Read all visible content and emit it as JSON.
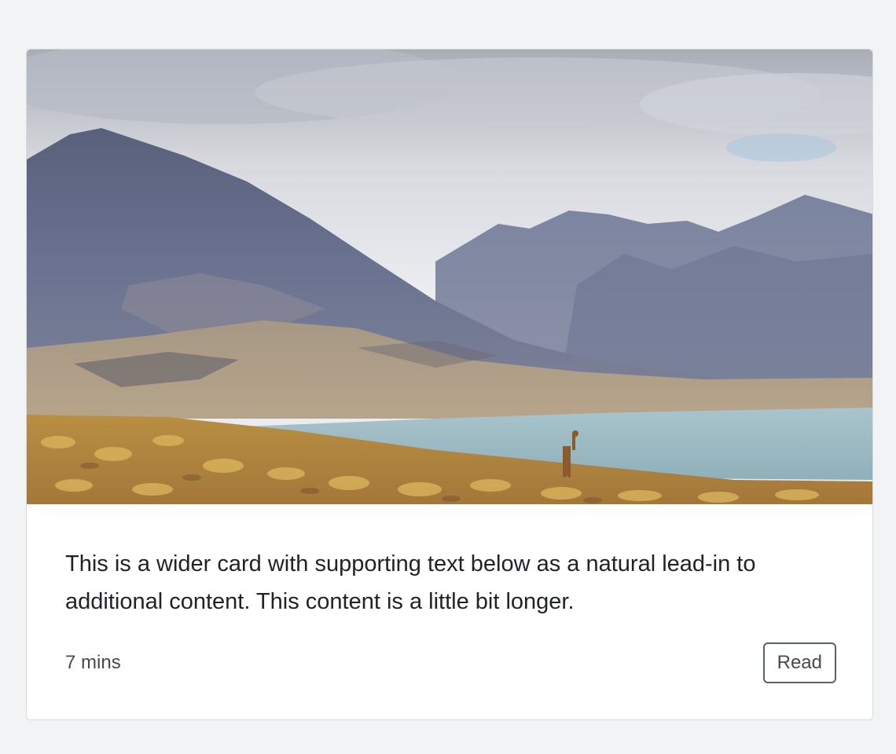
{
  "card": {
    "image_subject": "mountain-lake-landscape",
    "text": "This is a wider card with supporting text below as a natural lead-in to additional content. This content is a little bit longer.",
    "meta": "7 mins",
    "read_label": "Read"
  },
  "colors": {
    "page_background": "#f2f3f5",
    "card_background": "#ffffff",
    "card_border": "#d9dcdf",
    "button_border": "#5b6168",
    "text": "#1f2328",
    "muted_text": "#454b52"
  }
}
